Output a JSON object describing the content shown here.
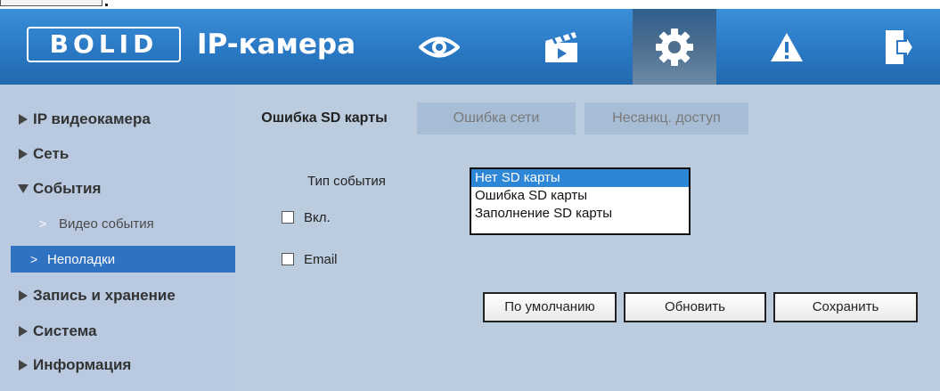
{
  "header": {
    "logo_text": "BOLID",
    "app_title": "IP-камера",
    "nav": [
      {
        "icon": "eye-icon"
      },
      {
        "icon": "clapperboard-icon"
      },
      {
        "icon": "gear-icon",
        "active": true
      },
      {
        "icon": "warning-icon"
      },
      {
        "icon": "logout-icon"
      }
    ]
  },
  "sidebar": {
    "items": [
      {
        "label": "IP видеокамера",
        "expanded": false
      },
      {
        "label": "Сеть",
        "expanded": false
      },
      {
        "label": "События",
        "expanded": true
      },
      {
        "label": "Видео события"
      },
      {
        "label": "Неполадки",
        "active": true
      },
      {
        "label": "Запись и хранение",
        "expanded": false
      },
      {
        "label": "Система",
        "expanded": false
      },
      {
        "label": "Информация",
        "expanded": false
      }
    ]
  },
  "tabs": [
    {
      "label": "Ошибка SD карты",
      "active": true
    },
    {
      "label": "Ошибка сети"
    },
    {
      "label": "Несанкц. доступ"
    }
  ],
  "form": {
    "event_type_label": "Тип события",
    "event_type_options": [
      "Нет SD карты",
      "Ошибка SD карты",
      "Заполнение SD карты"
    ],
    "event_type_selected": "Нет SD карты",
    "enable_label": "Вкл.",
    "enable_checked": false,
    "email_label": "Email",
    "email_checked": false
  },
  "buttons": {
    "default": "По умолчанию",
    "refresh": "Обновить",
    "save": "Сохранить"
  },
  "colors": {
    "header": "#2a78c4",
    "sidebar": "#b8c9e0",
    "content": "#bcccdf",
    "selected": "#2f72c2"
  }
}
